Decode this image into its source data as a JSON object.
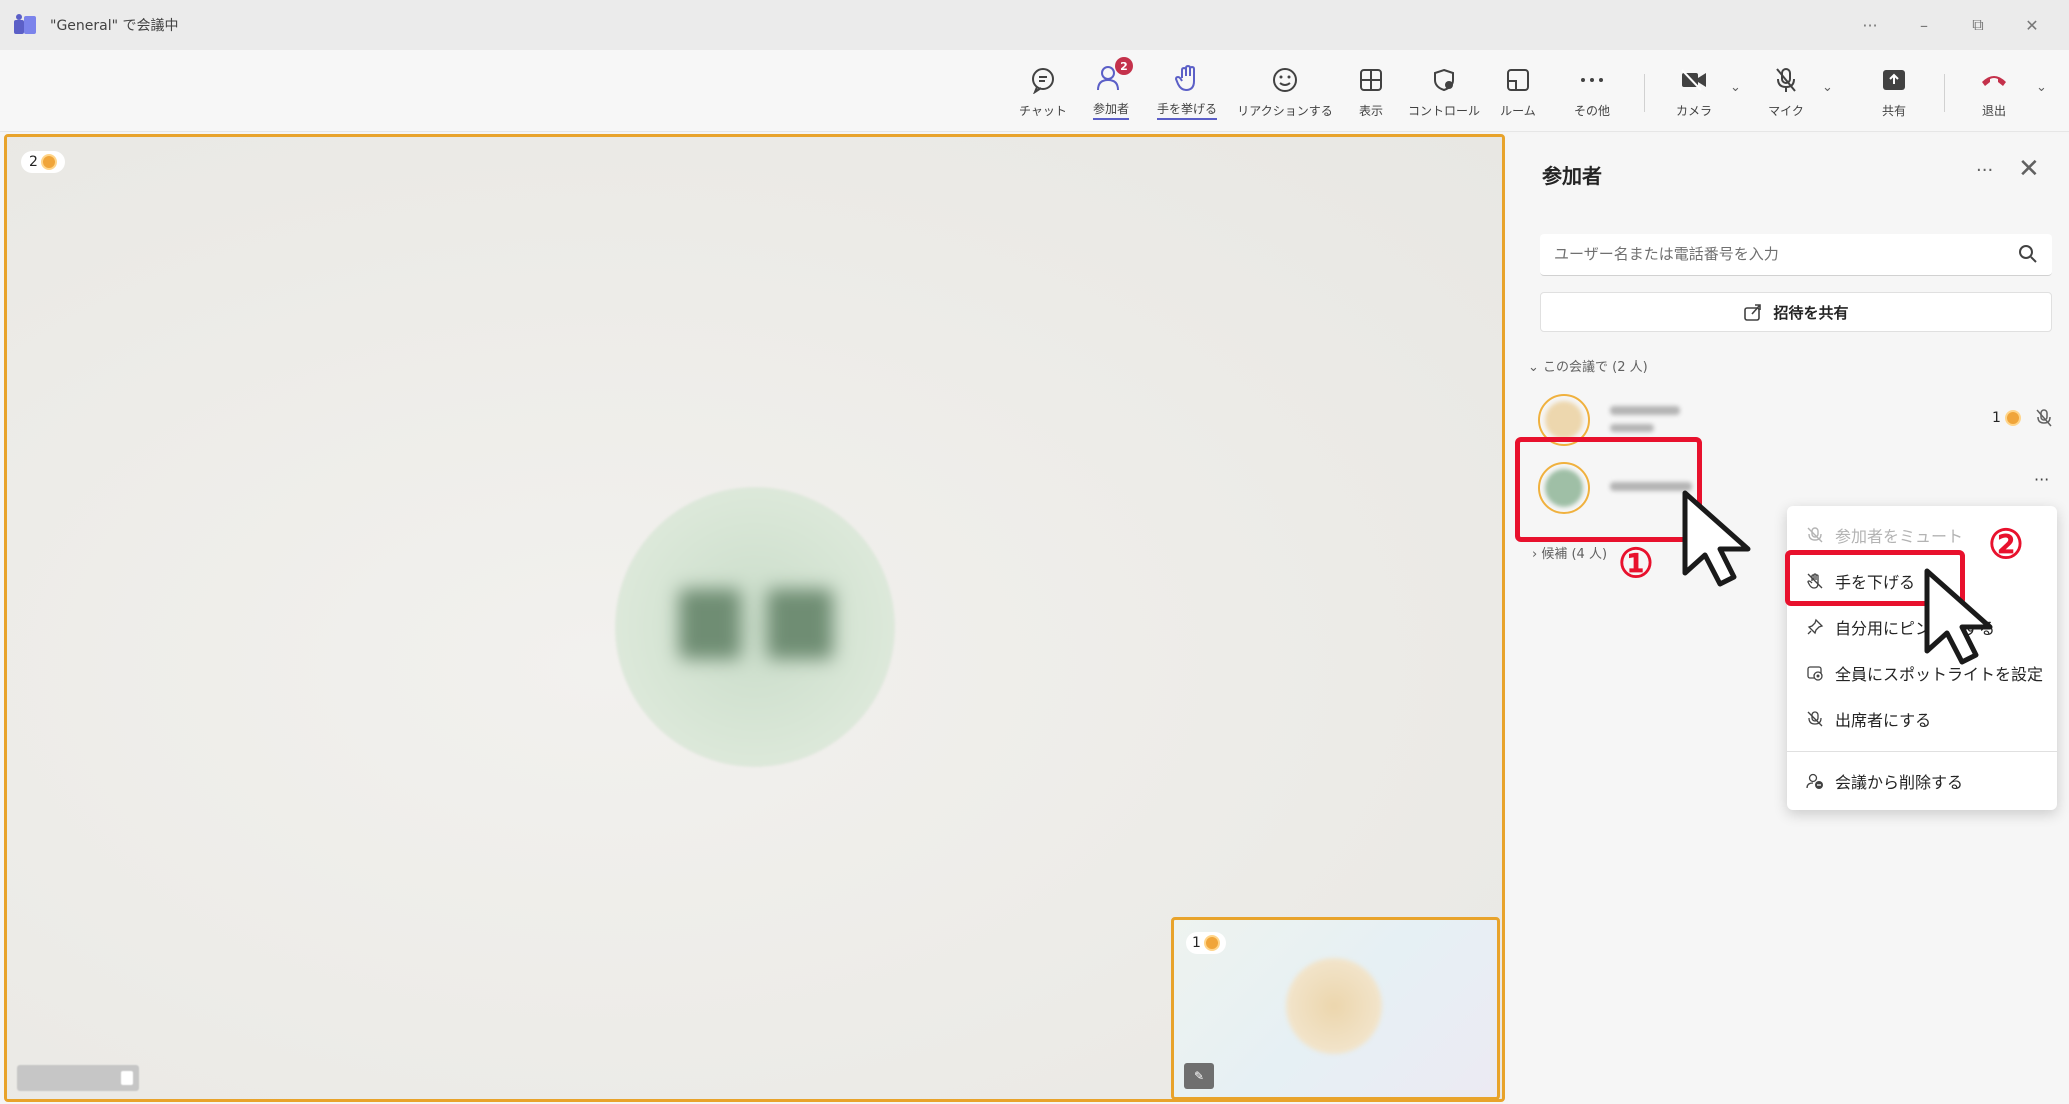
{
  "window": {
    "title": "\"General\" で会議中",
    "controls": [
      "···",
      "–",
      "⧉",
      "✕"
    ]
  },
  "toolbar": {
    "chat": "チャット",
    "participants": "参加者",
    "participants_badge": "2",
    "raise_hand": "手を挙げる",
    "react": "リアクションする",
    "view": "表示",
    "control": "コントロール",
    "rooms": "ルーム",
    "more": "その他",
    "camera": "カメラ",
    "mic": "マイク",
    "share": "共有",
    "leave": "退出"
  },
  "stage": {
    "raised_count": "2",
    "pip_raised_count": "1"
  },
  "panel": {
    "title": "参加者",
    "more": "···",
    "close": "✕",
    "search_placeholder": "ユーザー名または電話番号を入力",
    "share_invite": "招待を共有",
    "section_in_meeting": "この会議で (2 人)",
    "person1_badge": "1",
    "row_more": "···",
    "section_others": "候補 (4 人)"
  },
  "context_menu": {
    "mute": "参加者をミュート",
    "lower_hand": "手を下げる",
    "pin_for_me": "自分用にピン留めする",
    "spotlight": "全員にスポットライトを設定",
    "make_attendee": "出席者にする",
    "remove": "会議から削除する"
  },
  "annotations": {
    "step1": "①",
    "step2": "②",
    "color": "#e8112d"
  },
  "colors": {
    "accent": "#5b5fc7",
    "raised_hand_border": "#e8a32b",
    "leave": "#c4314b"
  }
}
